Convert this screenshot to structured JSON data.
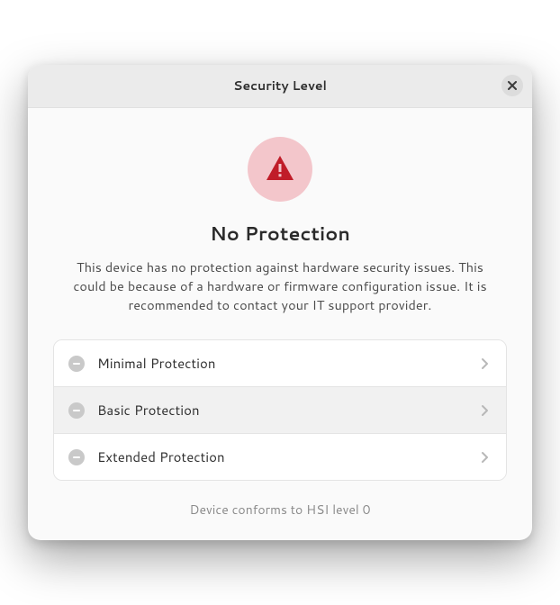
{
  "titlebar": {
    "title": "Security Level"
  },
  "status": {
    "heading": "No Protection",
    "description": "This device has no protection against hardware security issues. This could be because of a hardware or firmware configuration issue. It is recommended to contact your IT support provider.",
    "icon": "warning-triangle",
    "icon_bg": "#f3c6cb",
    "icon_fg": "#c01c28"
  },
  "levels": [
    {
      "label": "Minimal Protection",
      "status_icon": "minus"
    },
    {
      "label": "Basic Protection",
      "status_icon": "minus"
    },
    {
      "label": "Extended Protection",
      "status_icon": "minus"
    }
  ],
  "footer": {
    "hsi_text": "Device conforms to HSI level 0"
  }
}
